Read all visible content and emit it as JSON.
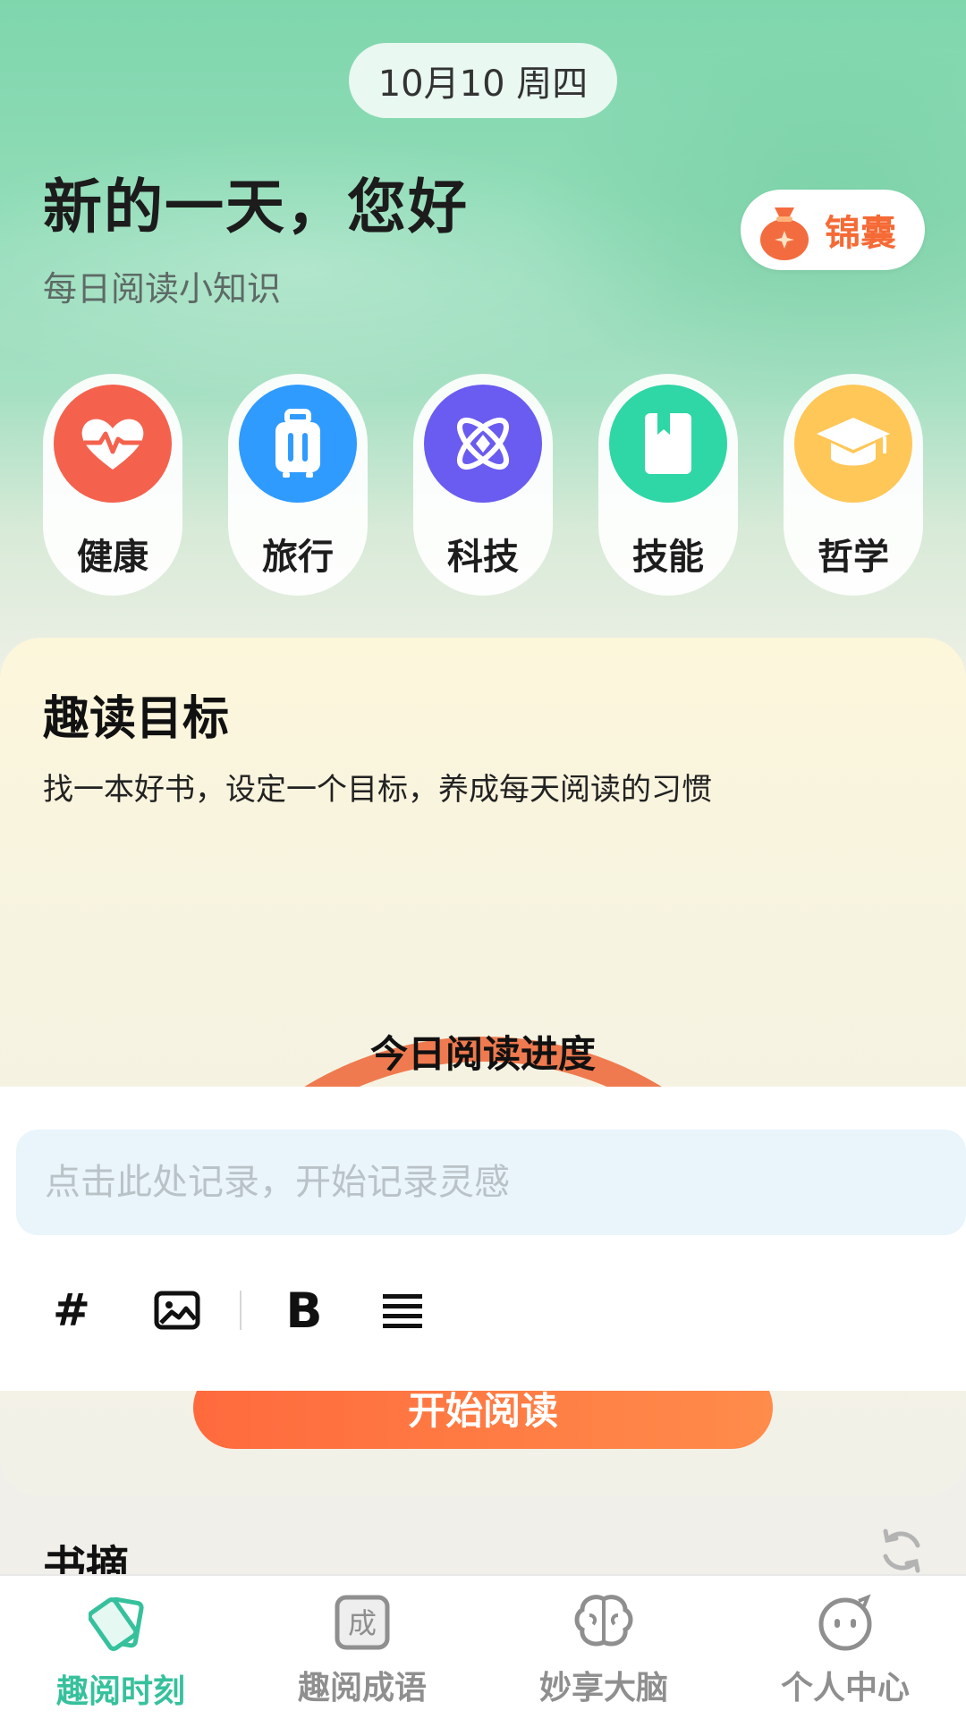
{
  "header": {
    "date": "10月10 周四",
    "greeting": "新的一天，您好",
    "subtitle": "每日阅读小知识",
    "bag_label": "锦囊"
  },
  "categories": [
    {
      "label": "健康",
      "icon": "heart-pulse-icon",
      "color": "#f4624e"
    },
    {
      "label": "旅行",
      "icon": "suitcase-icon",
      "color": "#2f9bff"
    },
    {
      "label": "科技",
      "icon": "atom-icon",
      "color": "#6a5cf0"
    },
    {
      "label": "技能",
      "icon": "book-icon",
      "color": "#2fd6a6"
    },
    {
      "label": "哲学",
      "icon": "graduation-cap-icon",
      "color": "#ffc758"
    }
  ],
  "goal": {
    "title": "趣读目标",
    "description": "找一本好书，设定一个目标，养成每天阅读的习惯",
    "progress_label": "今日阅读进度",
    "start_button": "开始阅读"
  },
  "editor": {
    "placeholder": "点击此处记录，开始记录灵感",
    "toolbar": [
      "#",
      "image-icon",
      "B",
      "align-icon"
    ]
  },
  "excerpt": {
    "title": "书摘"
  },
  "bottom_nav": [
    {
      "label": "趣阅时刻",
      "icon": "cards-icon",
      "active": true
    },
    {
      "label": "趣阅成语",
      "icon": "idiom-icon",
      "active": false
    },
    {
      "label": "妙享大脑",
      "icon": "brain-icon",
      "active": false
    },
    {
      "label": "个人中心",
      "icon": "face-icon",
      "active": false
    }
  ],
  "colors": {
    "accent": "#36c19c",
    "orange": "#f56a35",
    "progress_arc": "#ef7a4f"
  }
}
